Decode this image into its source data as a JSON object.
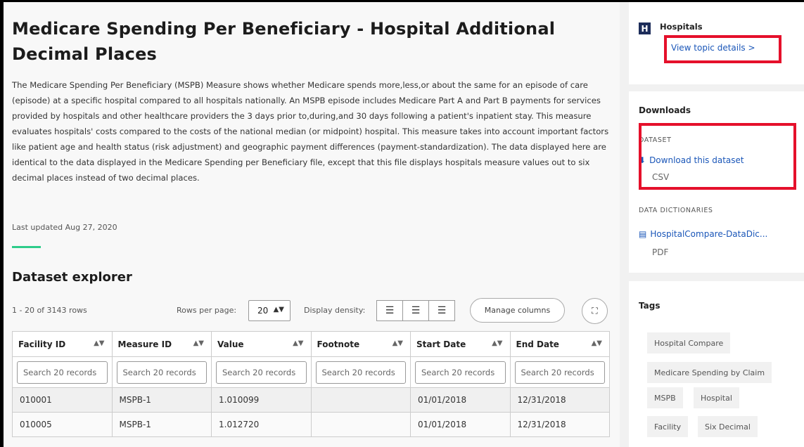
{
  "dataset": {
    "title": "Medicare Spending Per Beneficiary - Hospital Additional Decimal Places",
    "description": "The Medicare Spending Per Beneficiary (MSPB) Measure shows whether Medicare spends more,less,or about the same for an episode of care (episode) at a specific hospital compared to all hospitals nationally. An MSPB episode includes Medicare Part A and Part B payments for services provided by hospitals and other healthcare providers the 3 days prior to,during,and 30 days following a patient's inpatient stay. This measure evaluates hospitals' costs compared to the costs of the national median (or midpoint) hospital. This measure takes into account important factors like patient age and health status (risk adjustment) and geographic payment differences (payment-standardization). The data displayed here are identical to the data displayed in the Medicare Spending per Beneficiary file, except that this file displays hospitals measure values out to six decimal places instead of two decimal places.",
    "last_updated": "Last updated Aug 27, 2020"
  },
  "explorer": {
    "title": "Dataset explorer",
    "rows_count": "1 - 20 of 3143 rows",
    "rows_per_page_label": "Rows per page:",
    "rows_per_page_value": "20",
    "display_density_label": "Display density:",
    "manage_columns_label": "Manage columns",
    "columns": [
      "Facility ID",
      "Measure ID",
      "Value",
      "Footnote",
      "Start Date",
      "End Date"
    ],
    "filter_placeholders": [
      "Search 20 records",
      "Search 20 records",
      "Search 20 records",
      "Search 20 records",
      "Search 20 records",
      "Search 20 records"
    ],
    "rows": [
      [
        "010001",
        "MSPB-1",
        "1.010099",
        "",
        "01/01/2018",
        "12/31/2018"
      ],
      [
        "010005",
        "MSPB-1",
        "1.012720",
        "",
        "01/01/2018",
        "12/31/2018"
      ]
    ]
  },
  "topic": {
    "logo_letter": "H",
    "name": "Hospitals",
    "link_label": "View topic details >"
  },
  "downloads": {
    "heading": "Downloads",
    "dataset_label": "DATASET",
    "dataset_link": "Download this dataset",
    "dataset_format": "CSV",
    "dictionaries_label": "DATA DICTIONARIES",
    "dictionary_link": "HospitalCompare-DataDic...",
    "dictionary_format": "PDF"
  },
  "tags": {
    "heading": "Tags",
    "items": [
      "Hospital Compare",
      "Medicare Spending by Claim",
      "MSPB",
      "Hospital",
      "Facility",
      "Six Decimal"
    ]
  },
  "colors": {
    "link": "#1a56b8",
    "accent": "#2ecc8a",
    "highlight_box": "#e5102b",
    "logo_bg": "#1d2d5a"
  },
  "icons": {
    "sort": "sort-arrows-icon",
    "select_arrow": "select-arrows-icon",
    "density": [
      "density-compact-icon",
      "density-normal-icon",
      "density-expanded-icon"
    ],
    "fullscreen": "fullscreen-icon",
    "download": "download-icon",
    "document": "document-icon"
  }
}
